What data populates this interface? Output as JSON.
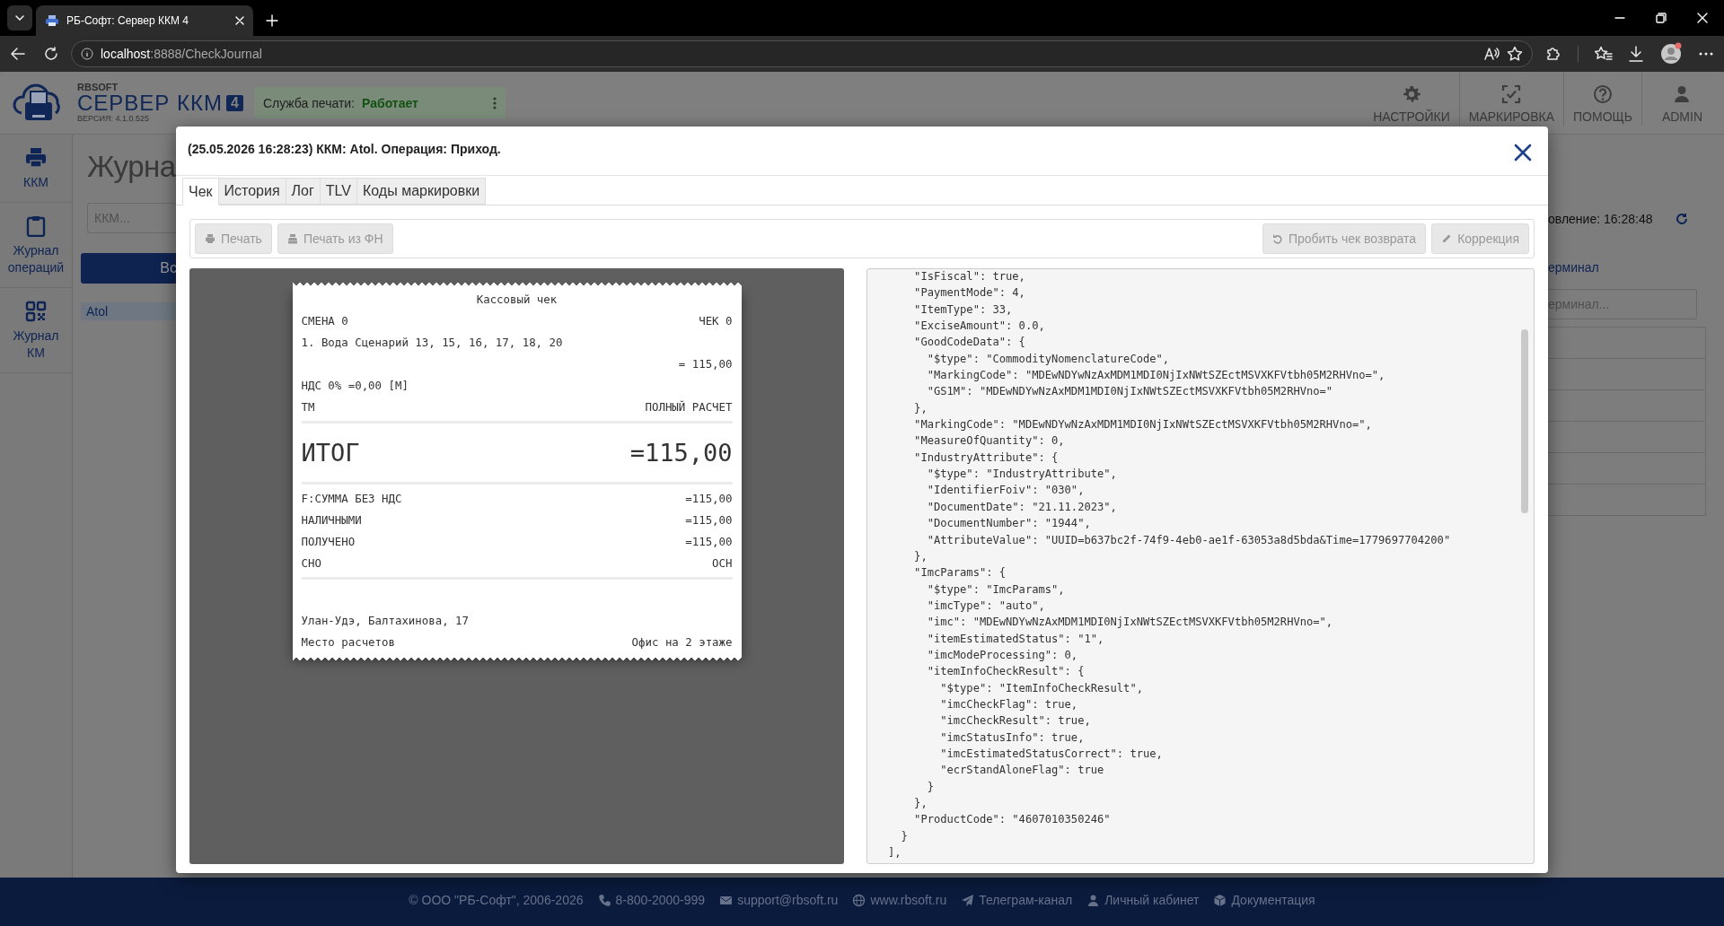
{
  "browser": {
    "tab_title": "РБ-Софт: Сервер ККМ 4",
    "url_host": "localhost",
    "url_path": ":8888/CheckJournal"
  },
  "header": {
    "brand": "RBSOFT",
    "product": "СЕРВЕР ККМ",
    "product_badge": "4",
    "version": "ВЕРСИЯ: 4.1.0.525",
    "print_service": {
      "label": "Служба печати:",
      "status": "Работает"
    },
    "nav": [
      {
        "label": "НАСТРОЙКИ"
      },
      {
        "label": "МАРКИРОВКА"
      },
      {
        "label": "ПОМОЩЬ"
      },
      {
        "label": "ADMIN"
      }
    ]
  },
  "sidebar": {
    "items": [
      {
        "label": "ККМ"
      },
      {
        "label": "Журнал операций"
      },
      {
        "label": "Журнал КМ"
      }
    ]
  },
  "background_page": {
    "title": "Журна",
    "search_placeholder": "ККМ...",
    "button": "Вс",
    "list_item": "Atol",
    "updated": "овление: 16:28:48",
    "terminal_label": "ерминал",
    "terminal_placeholder": "ерминал..."
  },
  "modal": {
    "title": "(25.05.2026 16:28:23) ККМ: Atol. Операция: Приход.",
    "tabs": [
      {
        "label": "Чек",
        "selected": true
      },
      {
        "label": "История",
        "selected": false
      },
      {
        "label": "Лог",
        "selected": false
      },
      {
        "label": "TLV",
        "selected": false
      },
      {
        "label": "Коды маркировки",
        "selected": false
      }
    ],
    "toolbar_left": [
      {
        "label": "Печать",
        "disabled": true
      },
      {
        "label": "Печать из ФН",
        "disabled": true
      }
    ],
    "toolbar_right": [
      {
        "label": "Пробить чек возврата",
        "disabled": true
      },
      {
        "label": "Коррекция",
        "disabled": true
      }
    ],
    "receipt": [
      {
        "kind": "title",
        "text": "Кассовый чек"
      },
      {
        "kind": "pair",
        "left": "СМЕНА 0",
        "right": "ЧЕК 0"
      },
      {
        "kind": "left",
        "text": "1. Вода Сценарий 13, 15, 16, 17, 18, 20"
      },
      {
        "kind": "right",
        "text": "= 115,00"
      },
      {
        "kind": "left",
        "text": "НДС 0% =0,00 [М]"
      },
      {
        "kind": "pair",
        "left": "ТМ",
        "right": "ПОЛНЫЙ РАСЧЕТ"
      },
      {
        "kind": "divider"
      },
      {
        "kind": "total",
        "left": "ИТОГ",
        "right": "=115,00"
      },
      {
        "kind": "divider"
      },
      {
        "kind": "pair",
        "left": "F:СУММА БЕЗ НДС",
        "right": "=115,00"
      },
      {
        "kind": "pair",
        "left": "НАЛИЧНЫМИ",
        "right": "=115,00"
      },
      {
        "kind": "pair",
        "left": "ПОЛУЧЕНО",
        "right": "=115,00"
      },
      {
        "kind": "pair",
        "left": "СНО",
        "right": "ОСН"
      },
      {
        "kind": "divider"
      },
      {
        "kind": "spacer"
      },
      {
        "kind": "left",
        "text": "Улан-Удэ, Балтахинова, 17"
      },
      {
        "kind": "pair",
        "left": "Место расчетов",
        "right": "Офис на 2 этаже"
      }
    ],
    "code_lines": [
      "    \"IsFiscal\": true,",
      "    \"PaymentMode\": 4,",
      "    \"ItemType\": 33,",
      "    \"ExciseAmount\": 0.0,",
      "    \"GoodCodeData\": {",
      "      \"$type\": \"CommodityNomenclatureCode\",",
      "      \"MarkingCode\": \"MDEwNDYwNzAxMDM1MDI0NjIxNWtSZEctMSVXKFVtbh05M2RHVno=\",",
      "      \"GS1M\": \"MDEwNDYwNzAxMDM1MDI0NjIxNWtSZEctMSVXKFVtbh05M2RHVno=\"",
      "    },",
      "    \"MarkingCode\": \"MDEwNDYwNzAxMDM1MDI0NjIxNWtSZEctMSVXKFVtbh05M2RHVno=\",",
      "    \"MeasureOfQuantity\": 0,",
      "    \"IndustryAttribute\": {",
      "      \"$type\": \"IndustryAttribute\",",
      "      \"IdentifierFoiv\": \"030\",",
      "      \"DocumentDate\": \"21.11.2023\",",
      "      \"DocumentNumber\": \"1944\",",
      "      \"AttributeValue\": \"UUID=b637bc2f-74f9-4eb0-ae1f-63053a8d5bda&Time=1779697704200\"",
      "    },",
      "    \"ImcParams\": {",
      "      \"$type\": \"ImcParams\",",
      "      \"imcType\": \"auto\",",
      "      \"imc\": \"MDEwNDYwNzAxMDM1MDI0NjIxNWtSZEctMSVXKFVtbh05M2RHVno=\",",
      "      \"itemEstimatedStatus\": \"1\",",
      "      \"imcModeProcessing\": 0,",
      "      \"itemInfoCheckResult\": {",
      "        \"$type\": \"ItemInfoCheckResult\",",
      "        \"imcCheckFlag\": true,",
      "        \"imcCheckResult\": true,",
      "        \"imcStatusInfo\": true,",
      "        \"imcEstimatedStatusCorrect\": true,",
      "        \"ecrStandAloneFlag\": true",
      "      }",
      "    },",
      "    \"ProductCode\": \"4607010350246\"",
      "  }",
      "],"
    ]
  },
  "footer": {
    "items": [
      "© ООО \"РБ-Софт\", 2006-2026",
      "8-800-2000-999",
      "support@rbsoft.ru",
      "www.rbsoft.ru",
      "Телеграм-канал",
      "Личный кабинет",
      "Документация"
    ]
  }
}
